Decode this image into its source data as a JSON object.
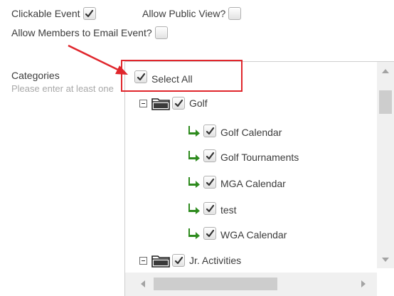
{
  "options": {
    "clickable_event": {
      "label": "Clickable Event",
      "checked": true
    },
    "allow_public_view": {
      "label": "Allow Public View?",
      "checked": false
    },
    "allow_members_email": {
      "label": "Allow Members to Email Event?",
      "checked": false
    }
  },
  "categories": {
    "label": "Categories",
    "hint": "Please enter at least one",
    "select_all": {
      "label": "Select All",
      "checked": true
    },
    "groups": [
      {
        "label": "Golf",
        "checked": true,
        "icon": "folder-icon",
        "children": [
          {
            "label": "Golf Calendar",
            "checked": true
          },
          {
            "label": "Golf Tournaments",
            "checked": true
          },
          {
            "label": "MGA Calendar",
            "checked": true
          },
          {
            "label": "test",
            "checked": true
          },
          {
            "label": "WGA Calendar",
            "checked": true
          }
        ]
      },
      {
        "label": "Jr. Activities",
        "checked": true,
        "icon": "folder-icon",
        "children": []
      }
    ]
  },
  "colors": {
    "annotation": "#e0262c",
    "leaf_arrow": "#2e8b1e",
    "checkmark": "#333333"
  }
}
